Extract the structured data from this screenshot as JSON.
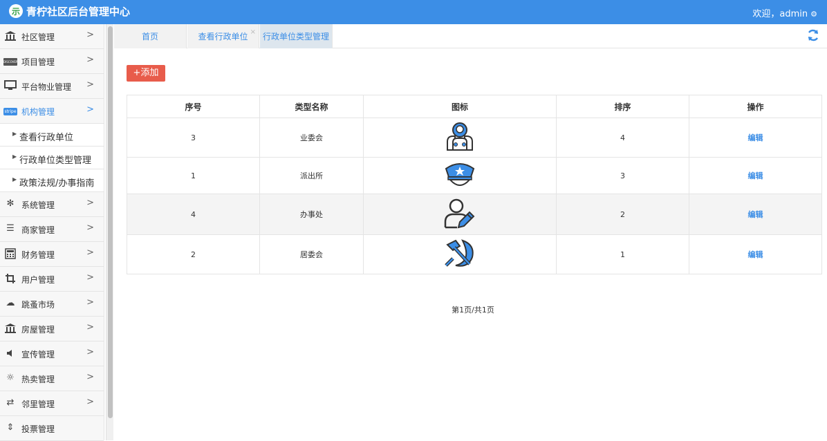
{
  "header": {
    "title": "青柠社区后台管理中心",
    "welcome": "欢迎，admin",
    "logo_glyph": "示"
  },
  "sidebar": {
    "items": [
      {
        "label": "社区管理",
        "icon": "bank-icon"
      },
      {
        "label": "项目管理",
        "icon": "discover-card-icon"
      },
      {
        "label": "平台物业管理",
        "icon": "monitor-icon"
      },
      {
        "label": "机构管理",
        "icon": "stripe-icon",
        "active": true
      },
      {
        "label": "系统管理",
        "icon": "yelp-icon"
      },
      {
        "label": "商家管理",
        "icon": "list-icon"
      },
      {
        "label": "财务管理",
        "icon": "calculator-icon"
      },
      {
        "label": "用户管理",
        "icon": "crop-icon"
      },
      {
        "label": "跳蚤市场",
        "icon": "cloud-icon"
      },
      {
        "label": "房屋管理",
        "icon": "bank-icon"
      },
      {
        "label": "宣传管理",
        "icon": "volume-icon"
      },
      {
        "label": "热卖管理",
        "icon": "sun-icon"
      },
      {
        "label": "邻里管理",
        "icon": "retweet-icon"
      },
      {
        "label": "投票管理",
        "icon": "sort-icon"
      }
    ],
    "subitems": [
      {
        "label": "查看行政单位"
      },
      {
        "label": "行政单位类型管理"
      },
      {
        "label": "政策法规/办事指南"
      }
    ],
    "stripe_badge": "stripe",
    "discover_badge": "DISCOVER"
  },
  "tabs": [
    {
      "label": "首页"
    },
    {
      "label": "查看行政单位",
      "close": "×"
    },
    {
      "label": "行政单位类型管理",
      "active": true
    }
  ],
  "toolbar": {
    "add_label": "+添加"
  },
  "table": {
    "headers": [
      "序号",
      "类型名称",
      "图标",
      "排序",
      "操作"
    ],
    "rows": [
      {
        "id": "3",
        "name": "业委会",
        "icon": "committee-icon",
        "order": "4",
        "action": "编辑"
      },
      {
        "id": "1",
        "name": "派出所",
        "icon": "police-cap-icon",
        "order": "3",
        "action": "编辑"
      },
      {
        "id": "4",
        "name": "办事处",
        "icon": "user-edit-icon",
        "order": "2",
        "action": "编辑"
      },
      {
        "id": "2",
        "name": "居委会",
        "icon": "hammer-sickle-icon",
        "order": "1",
        "action": "编辑"
      }
    ]
  },
  "pager": {
    "text": "第1页/共1页"
  },
  "colors": {
    "primary": "#3c8ee6",
    "danger": "#e85c4b",
    "logo_green": "#3aa34c"
  }
}
